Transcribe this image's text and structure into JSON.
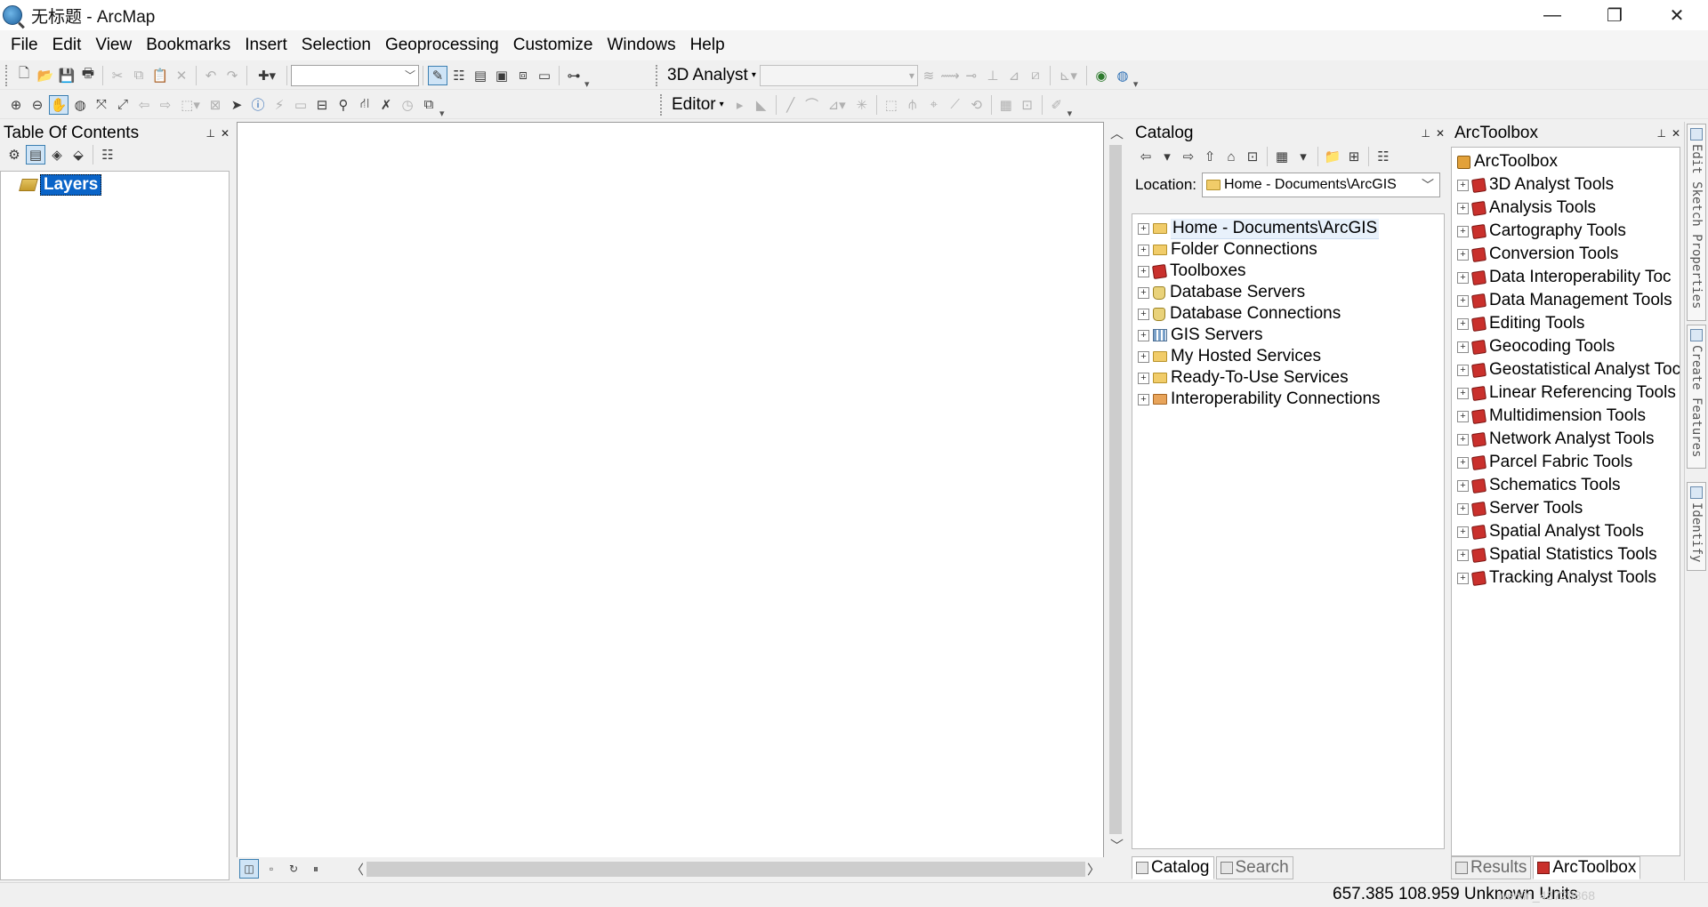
{
  "window": {
    "title": "无标题 - ArcMap",
    "minimize": "—",
    "maximize": "❐",
    "close": "✕"
  },
  "menu": [
    "File",
    "Edit",
    "View",
    "Bookmarks",
    "Insert",
    "Selection",
    "Geoprocessing",
    "Customize",
    "Windows",
    "Help"
  ],
  "toolbars": {
    "analyst_label": "3D Analyst",
    "editor_label": "Editor"
  },
  "toc": {
    "title": "Table Of Contents",
    "layers_label": "Layers"
  },
  "catalog": {
    "title": "Catalog",
    "location_label": "Location:",
    "location_value": "Home - Documents\\ArcGIS",
    "items": [
      {
        "label": "Home - Documents\\ArcGIS",
        "icon": "home-folder-icon"
      },
      {
        "label": "Folder Connections",
        "icon": "folder-icon"
      },
      {
        "label": "Toolboxes",
        "icon": "toolbox-icon"
      },
      {
        "label": "Database Servers",
        "icon": "database-server-icon"
      },
      {
        "label": "Database Connections",
        "icon": "database-icon"
      },
      {
        "label": "GIS Servers",
        "icon": "gis-server-icon"
      },
      {
        "label": "My Hosted Services",
        "icon": "folder-icon"
      },
      {
        "label": "Ready-To-Use Services",
        "icon": "folder-icon"
      },
      {
        "label": "Interoperability Connections",
        "icon": "folder-icon"
      }
    ],
    "tabs": [
      "Catalog",
      "Search"
    ]
  },
  "arctoolbox": {
    "title": "ArcToolbox",
    "root": "ArcToolbox",
    "tools": [
      "3D Analyst Tools",
      "Analysis Tools",
      "Cartography Tools",
      "Conversion Tools",
      "Data Interoperability Toc",
      "Data Management Tools",
      "Editing Tools",
      "Geocoding Tools",
      "Geostatistical Analyst Toc",
      "Linear Referencing Tools",
      "Multidimension Tools",
      "Network Analyst Tools",
      "Parcel Fabric Tools",
      "Schematics Tools",
      "Server Tools",
      "Spatial Analyst Tools",
      "Spatial Statistics Tools",
      "Tracking Analyst Tools"
    ],
    "tabs": [
      "Results",
      "ArcToolbox"
    ]
  },
  "side_tabs": [
    "Edit Sketch Properties",
    "Create Features",
    "Identify"
  ],
  "status": {
    "coords": "657.385  108.959 Unknown Units",
    "watermark": "weixin_43728868"
  }
}
